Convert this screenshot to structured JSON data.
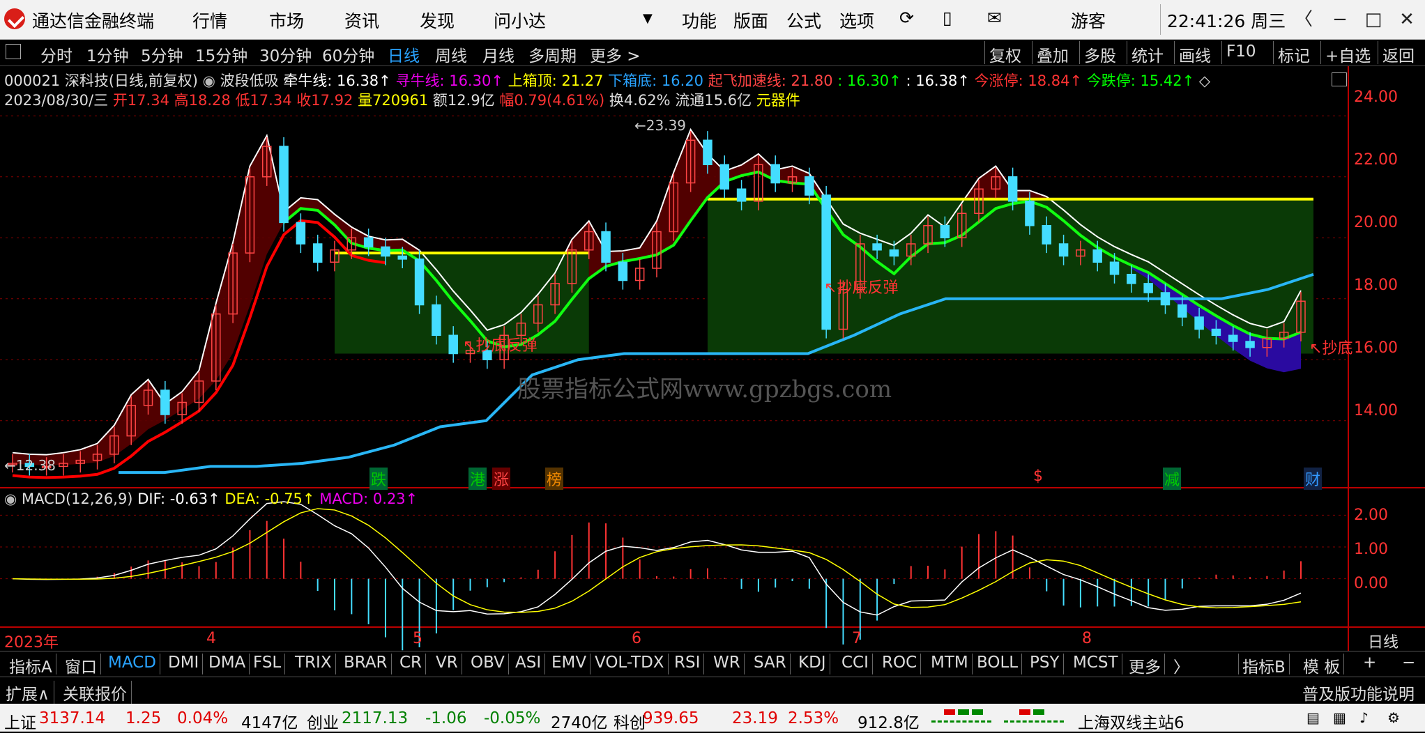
{
  "app": {
    "title": "通达信金融终端",
    "menu": [
      "行情",
      "市场",
      "资讯",
      "发现",
      "问小达"
    ],
    "right_menu": [
      "功能",
      "版面",
      "公式",
      "选项"
    ],
    "user": "游客",
    "clock": "22:41:26 周三"
  },
  "periods": [
    "分时",
    "1分钟",
    "5分钟",
    "15分钟",
    "30分钟",
    "60分钟",
    "日线",
    "周线",
    "月线",
    "多周期",
    "更多 >"
  ],
  "active_period": "日线",
  "right_tools": [
    "复权",
    "叠加",
    "多股",
    "统计",
    "画线",
    "F10",
    "标记",
    "+自选",
    "返回"
  ],
  "indicator_line": {
    "stock": "000021 深科技(日线,前复权)",
    "formula": "波段低吸",
    "qianniu": "牵牛线: 16.38↑",
    "xunniu": "寻牛线: 16.30↑",
    "shangxiang": "上箱顶: 21.27",
    "xiaxiang": "下箱底: 16.20",
    "qifei": "起飞加速线: 21.80",
    "v1": ": 16.30↑",
    "v2": ": 16.38↑",
    "zhangting": "今涨停: 18.84↑",
    "dieting": "今跌停: 15.42↑"
  },
  "quote_line": {
    "date": "2023/08/30/三",
    "open": "开17.34",
    "high": "高18.28",
    "low": "低17.34",
    "close": "收17.92",
    "vol": "量720961",
    "amount": "额12.9亿",
    "range": "幅0.79(4.61%)",
    "turnover": "换4.62%",
    "float": "流通15.6亿",
    "sector": "元器件"
  },
  "y_axis": [
    "24.00",
    "22.00",
    "20.00",
    "18.00",
    "16.00",
    "14.00"
  ],
  "macd_axis": [
    "2.00",
    "1.00",
    "0.00"
  ],
  "annotations": {
    "high": "23.39",
    "low": "12.38",
    "signal1": "抄底反弹",
    "signal2": "抄底反弹",
    "signal3": "抄底"
  },
  "events": [
    {
      "label": "跌",
      "color": "#0a0",
      "bg": "#063"
    },
    {
      "label": "港",
      "color": "#0a0",
      "bg": "#063"
    },
    {
      "label": "涨",
      "color": "#e22",
      "bg": "#600"
    },
    {
      "label": "榜",
      "color": "#c60",
      "bg": "#530"
    },
    {
      "label": "$",
      "color": "#e22",
      "bg": "#000"
    },
    {
      "label": "减",
      "color": "#0a0",
      "bg": "#063"
    },
    {
      "label": "财",
      "color": "#39f",
      "bg": "#124"
    }
  ],
  "macd_line": {
    "name": "MACD(12,26,9)",
    "dif": "DIF: -0.63↑",
    "dea": "DEA: -0.75↑",
    "macd": "MACD: 0.23↑"
  },
  "x_axis": {
    "year": "2023年",
    "months": [
      "4",
      "5",
      "6",
      "7",
      "8"
    ],
    "period_label": "日线"
  },
  "watermark": "股票指标公式网www.gpzbgs.com",
  "indicator_tabs": [
    "指标A",
    "窗口",
    "MACD",
    "DMI",
    "DMA",
    "FSL",
    "TRIX",
    "BRAR",
    "CR",
    "VR",
    "OBV",
    "ASI",
    "EMV",
    "VOL-TDX",
    "RSI",
    "WR",
    "SAR",
    "KDJ",
    "CCI",
    "ROC",
    "MTM",
    "BOLL",
    "PSY",
    "MCST",
    "更多",
    "〉"
  ],
  "active_tab": "MACD",
  "tab_right": [
    "指标B",
    "模 板",
    "+",
    "−"
  ],
  "ext_bar": {
    "left1": "扩展∧",
    "left2": "关联报价",
    "right": "普及版功能说明"
  },
  "status": {
    "sh_name": "上证",
    "sh_val": "3137.14",
    "sh_chg": "1.25",
    "sh_pct": "0.04%",
    "sh_amt": "4147亿",
    "cy_name": "创业",
    "cy_val": "2117.13",
    "cy_chg": "-1.06",
    "cy_pct": "-0.05%",
    "cy_amt": "2740亿",
    "kc_name": "科创",
    "kc_val": "939.65",
    "kc_chg": "23.19",
    "kc_pct": "2.53%",
    "kc_amt": "912.8亿",
    "server": "上海双线主站6"
  },
  "chart_data": {
    "type": "candlestick",
    "x_months": [
      "4",
      "5",
      "6",
      "7",
      "8"
    ],
    "ylim": [
      11.8,
      24.6
    ],
    "price_ticks": [
      24,
      22,
      20,
      18,
      16,
      14
    ],
    "close_series": [
      12.6,
      12.5,
      12.5,
      12.6,
      12.7,
      12.9,
      13.5,
      14.5,
      15.0,
      14.2,
      14.6,
      15.3,
      17.5,
      19.5,
      22.0,
      23.0,
      20.5,
      19.8,
      19.2,
      19.6,
      20.0,
      19.7,
      19.4,
      19.3,
      17.8,
      16.8,
      16.2,
      16.3,
      16.0,
      16.8,
      17.2,
      17.8,
      18.5,
      19.6,
      20.2,
      19.2,
      18.6,
      19.0,
      20.2,
      21.8,
      23.2,
      22.4,
      21.6,
      21.2,
      22.4,
      21.8,
      22.0,
      21.4,
      17.0,
      18.3,
      19.8,
      19.6,
      19.4,
      19.8,
      20.4,
      20.0,
      20.8,
      21.6,
      22.0,
      21.2,
      20.4,
      19.8,
      19.4,
      19.6,
      19.2,
      18.8,
      18.5,
      18.2,
      17.8,
      17.4,
      17.0,
      16.8,
      16.6,
      16.4,
      16.7,
      16.9,
      17.92
    ],
    "yellow_line": [
      {
        "from": "05-12",
        "to": "05-31",
        "value": 19.5
      },
      {
        "from": "06-05",
        "to": "08-30",
        "value": 21.27
      }
    ],
    "cyan_line": [
      12.3,
      12.3,
      12.5,
      12.5,
      12.6,
      12.8,
      13.2,
      13.8,
      14.0,
      15.5,
      16.0,
      16.2,
      16.2,
      16.2,
      16.2,
      16.2,
      16.8,
      17.5,
      18.0,
      18.0,
      18.0,
      18.0,
      18.0,
      18.0,
      18.0,
      18.3,
      18.8
    ],
    "macd": {
      "dif": -0.63,
      "dea": -0.75,
      "macd": 0.23,
      "ylim": [
        -1.3,
        2.6
      ]
    }
  }
}
